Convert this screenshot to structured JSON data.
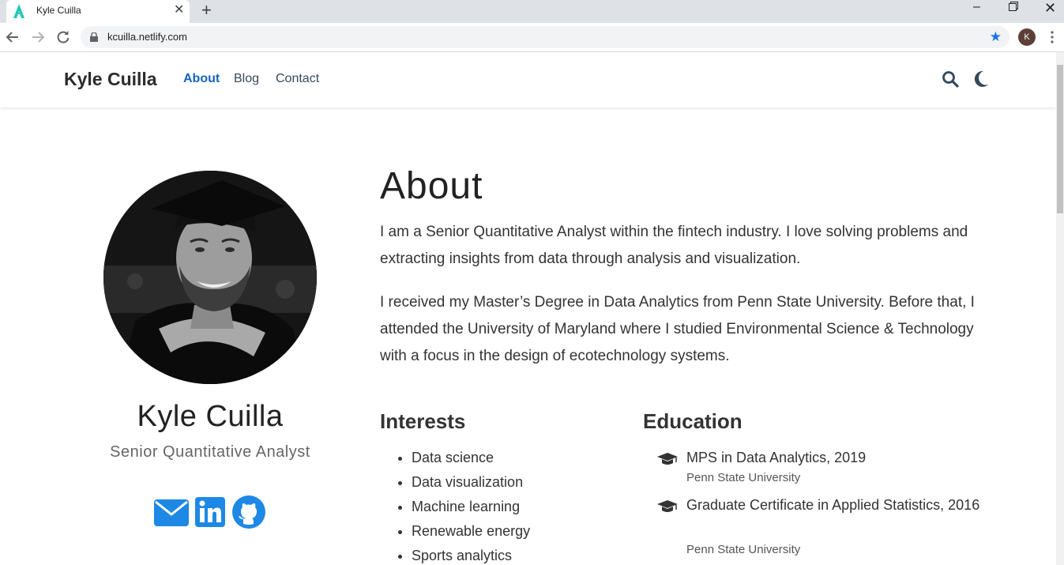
{
  "browser": {
    "tab_title": "Kyle Cuilla",
    "url": "kcuilla.netlify.com",
    "profile_initial": "K"
  },
  "navbar": {
    "brand": "Kyle Cuilla",
    "links": [
      {
        "label": "About",
        "active": true
      },
      {
        "label": "Blog",
        "active": false
      },
      {
        "label": "Contact",
        "active": false
      }
    ]
  },
  "profile": {
    "name": "Kyle Cuilla",
    "role": "Senior Quantitative Analyst",
    "social": [
      "envelope-icon",
      "linkedin-icon",
      "github-icon"
    ]
  },
  "about": {
    "title": "About",
    "paragraph1": "I am a Senior Quantitative Analyst within the fintech industry. I love solving problems and extracting insights from data through analysis and visualization.",
    "paragraph2": "I received my Master’s Degree in Data Analytics from Penn State University. Before that, I attended the University of Maryland where I studied Environmental Science & Technology with a focus in the design of ecotechnology systems."
  },
  "interests": {
    "title": "Interests",
    "items": [
      "Data science",
      "Data visualization",
      "Machine learning",
      "Renewable energy",
      "Sports analytics"
    ]
  },
  "education": {
    "title": "Education",
    "items": [
      {
        "degree": "MPS in Data Analytics, 2019",
        "school": "Penn State University"
      },
      {
        "degree": "Graduate Certificate in Applied Statistics, 2016",
        "school": "Penn State University"
      }
    ]
  },
  "colors": {
    "accent": "#1e88e5",
    "active_link": "#1565c0",
    "chrome_tabbar": "#dee1e6"
  }
}
